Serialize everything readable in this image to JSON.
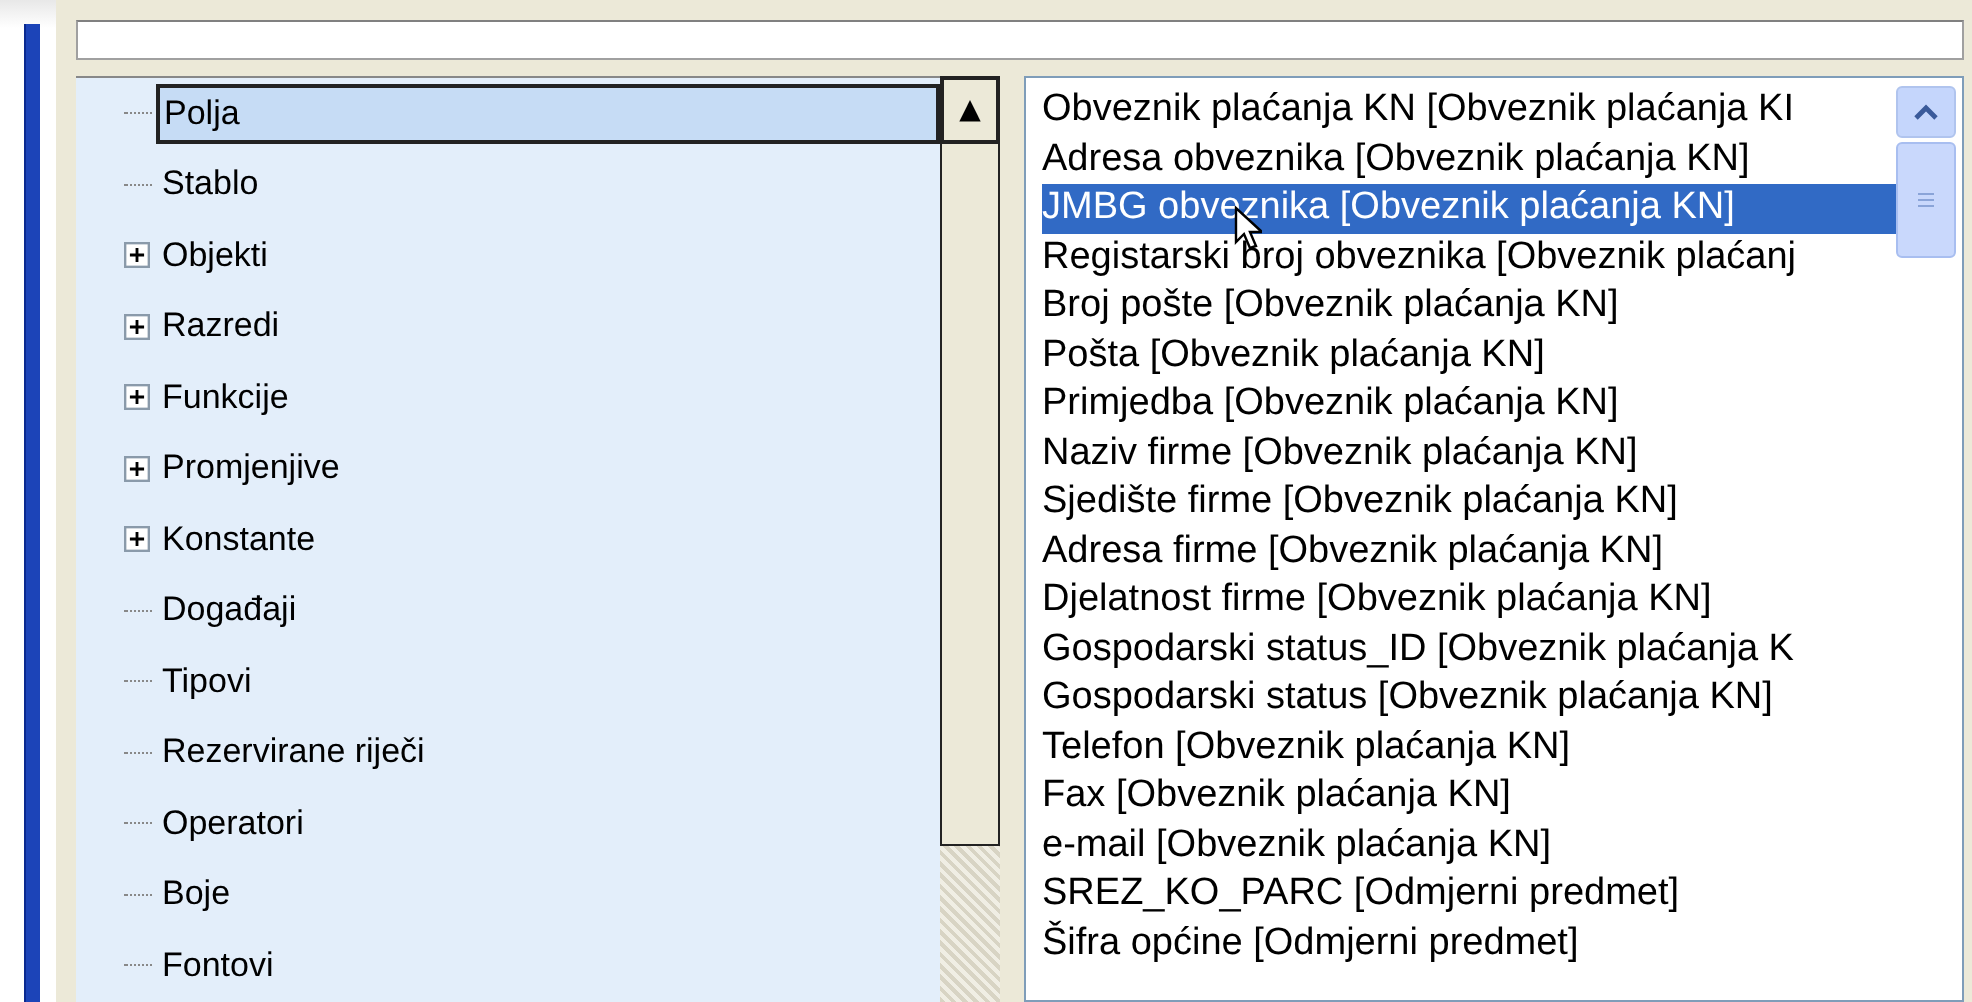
{
  "tree": {
    "items": [
      {
        "label": "Polja",
        "expandable": false,
        "selected": true
      },
      {
        "label": "Stablo",
        "expandable": false,
        "selected": false
      },
      {
        "label": "Objekti",
        "expandable": true,
        "selected": false
      },
      {
        "label": "Razredi",
        "expandable": true,
        "selected": false
      },
      {
        "label": "Funkcije",
        "expandable": true,
        "selected": false
      },
      {
        "label": "Promjenjive",
        "expandable": true,
        "selected": false
      },
      {
        "label": "Konstante",
        "expandable": true,
        "selected": false
      },
      {
        "label": "Događaji",
        "expandable": false,
        "selected": false
      },
      {
        "label": "Tipovi",
        "expandable": false,
        "selected": false
      },
      {
        "label": "Rezervirane riječi",
        "expandable": false,
        "selected": false
      },
      {
        "label": "Operatori",
        "expandable": false,
        "selected": false
      },
      {
        "label": "Boje",
        "expandable": false,
        "selected": false
      },
      {
        "label": "Fontovi",
        "expandable": false,
        "selected": false
      }
    ]
  },
  "tree_scrollbar": {
    "up_button": "▲"
  },
  "fields_list": {
    "items": [
      {
        "label": "Obveznik plaćanja KN [Obveznik plaćanja KI",
        "selected": false
      },
      {
        "label": "Adresa obveznika [Obveznik plaćanja KN]",
        "selected": false
      },
      {
        "label": "JMBG obveznika [Obveznik plaćanja KN]",
        "selected": true
      },
      {
        "label": "Registarski broj obveznika [Obveznik plaćanj",
        "selected": false
      },
      {
        "label": "Broj pošte [Obveznik plaćanja KN]",
        "selected": false
      },
      {
        "label": "Pošta [Obveznik plaćanja KN]",
        "selected": false
      },
      {
        "label": "Primjedba [Obveznik plaćanja KN]",
        "selected": false
      },
      {
        "label": "Naziv firme [Obveznik plaćanja KN]",
        "selected": false
      },
      {
        "label": "Sjedište firme [Obveznik plaćanja KN]",
        "selected": false
      },
      {
        "label": "Adresa firme [Obveznik plaćanja KN]",
        "selected": false
      },
      {
        "label": "Djelatnost firme [Obveznik plaćanja KN]",
        "selected": false
      },
      {
        "label": "Gospodarski status_ID [Obveznik plaćanja K",
        "selected": false
      },
      {
        "label": "Gospodarski status [Obveznik plaćanja KN]",
        "selected": false
      },
      {
        "label": "Telefon [Obveznik plaćanja KN]",
        "selected": false
      },
      {
        "label": "Fax [Obveznik plaćanja KN]",
        "selected": false
      },
      {
        "label": "e-mail [Obveznik plaćanja KN]",
        "selected": false
      },
      {
        "label": "SREZ_KO_PARC [Odmjerni predmet]",
        "selected": false
      },
      {
        "label": "Šifra općine [Odmjerni predmet]",
        "selected": false
      }
    ]
  }
}
